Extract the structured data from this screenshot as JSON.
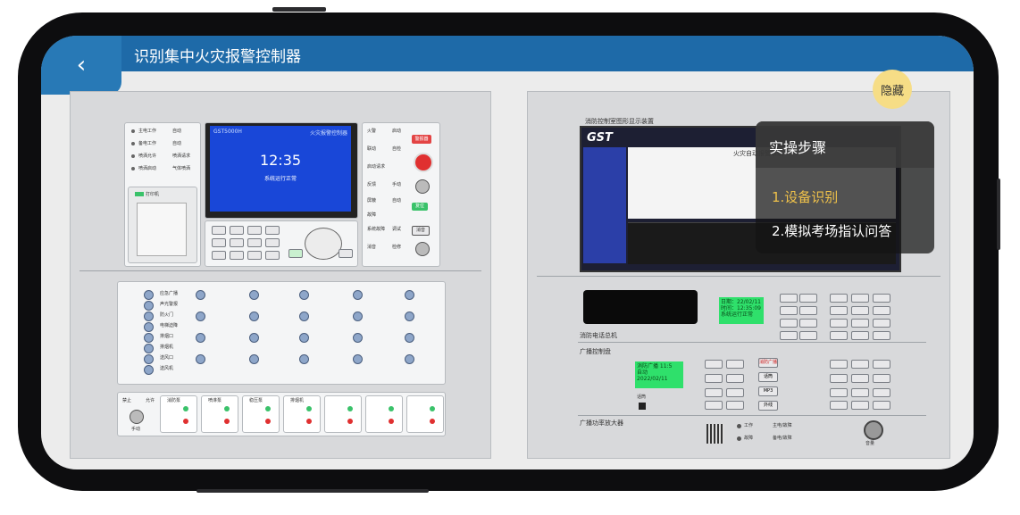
{
  "header": {
    "title": "识别集中火灾报警控制器",
    "back_icon": "chevron-left-icon"
  },
  "overlay": {
    "hide_label": "隐藏",
    "title": "实操步骤",
    "steps": [
      "1.设备识别",
      "2.模拟考场指认问答"
    ],
    "accent_color": "#f0c24a"
  },
  "left_panel": {
    "lcd": {
      "brand": "GST5000H",
      "system": "火灾报警控制器",
      "time": "12:35",
      "status": "系统运行正常"
    },
    "indicators_left": [
      "主电工作",
      "备电工作",
      "喷洒允许",
      "喷洒启动"
    ],
    "indicators_mid": [
      "自动",
      "自动",
      "喷洒请求",
      "气体喷洒"
    ],
    "right_indicators": [
      "火警",
      "联动",
      "启动请求",
      "反馈",
      "屏蔽",
      "故障",
      "系统故障",
      "消音"
    ],
    "right_labels": [
      "启动",
      "自检",
      "手动",
      "自动",
      "调试",
      "检修"
    ],
    "buttons": {
      "alarm": "警报器",
      "reset": "复位",
      "silence": "消音"
    },
    "printer_label": "打印机",
    "bus_labels": [
      "应急广播",
      "声光警报",
      "防火门",
      "电梯迫降",
      "排烟口",
      "排烟机",
      "送风口",
      "送风机"
    ],
    "manual_labels": [
      "禁止",
      "允许",
      "手动"
    ],
    "module_labels": [
      "消防泵",
      "喷淋泵",
      "稳压泵",
      "排烟机",
      "",
      "",
      ""
    ],
    "module_states": [
      "启动",
      "反馈",
      "故障"
    ]
  },
  "right_panel": {
    "graphics_title": "消防控制室图形显示装置",
    "gst_logo": "GST",
    "graphics_header": "火灾自动报警系统",
    "phone_label": "消防电话总机",
    "broadcast_label": "广播控制盘",
    "amp_label": "广播功率放大器",
    "phone_lcd": [
      "日期：22/02/11",
      "时间：12:35:09",
      "系统运行正常"
    ],
    "broadcast_lcd": [
      "消防广播 11:5",
      "自动",
      "2022/02/11",
      "12:35"
    ],
    "broadcast_keys": [
      "消防广播",
      "话筒",
      "MP3",
      "外线"
    ],
    "speaker_label": "话筒",
    "amp_legend": [
      "工作",
      "故障",
      "主电/故障",
      "备电/故障"
    ],
    "volume_label": "音量"
  }
}
